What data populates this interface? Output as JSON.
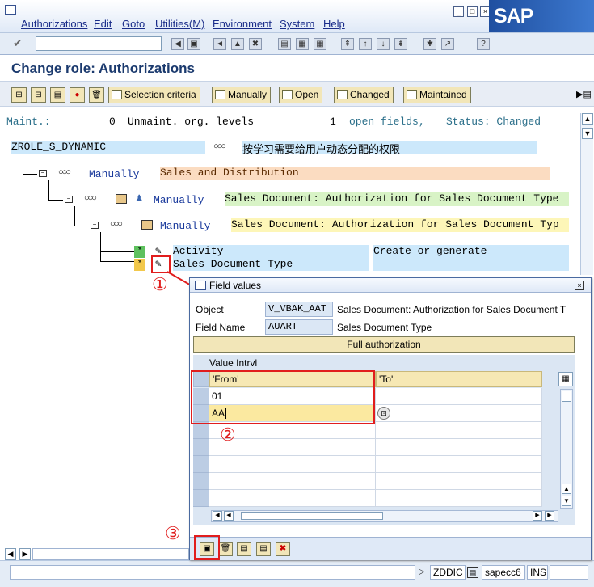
{
  "menu": {
    "items": [
      "Authorizations",
      "Edit",
      "Goto",
      "Utilities(M)",
      "Environment",
      "System",
      "Help"
    ],
    "logo": "SAP"
  },
  "window_buttons": [
    "minimize",
    "restore",
    "close"
  ],
  "toolbar": {
    "command_field_value": ""
  },
  "page": {
    "title": "Change role: Authorizations"
  },
  "app_toolbar": {
    "buttons": [
      "Selection criteria",
      "Manually",
      "Open",
      "Changed",
      "Maintained"
    ]
  },
  "status_line": {
    "maint_label": "Maint.:",
    "maint_count": "0",
    "unmaint_label": "Unmaint. org. levels",
    "open_count": "1",
    "open_label": "open fields,",
    "status_label": "Status: Changed"
  },
  "tree": {
    "role_name": "ZROLE_S_DYNAMIC",
    "role_desc": "按学习需要给用户动态分配的权限",
    "level1": {
      "status": "Manually",
      "text": "Sales and Distribution"
    },
    "level2": {
      "status": "Manually",
      "text": "Sales Document: Authorization for Sales Document Type"
    },
    "level3": {
      "status": "Manually",
      "text": "Sales Document: Authorization for Sales Document Typ"
    },
    "fields": [
      {
        "marker": "*",
        "name": "Activity",
        "value": "Create or generate"
      },
      {
        "marker": "*",
        "name": "Sales Document Type",
        "value": ""
      }
    ]
  },
  "dialog": {
    "title": "Field values",
    "object_label": "Object",
    "object_value": "V_VBAK_AAT",
    "object_desc": "Sales Document: Authorization for Sales Document T",
    "field_label": "Field Name",
    "field_value": "AUART",
    "field_desc": "Sales Document Type",
    "full_auth_label": "Full authorization",
    "table_title": "Value Intrvl",
    "col_from": "'From'",
    "col_to": "'To'",
    "rows": [
      {
        "from": "01",
        "to": ""
      },
      {
        "from": "AA",
        "to": ""
      }
    ]
  },
  "annotations": [
    "①",
    "②",
    "③"
  ],
  "statusbar": {
    "system": "ZDDIC",
    "server": "sapecc6",
    "mode": "INS"
  },
  "colors": {
    "annotation_red": "#e11d1d",
    "title_blue": "#1b3a6e",
    "button_tan": "#f2e6b8"
  }
}
